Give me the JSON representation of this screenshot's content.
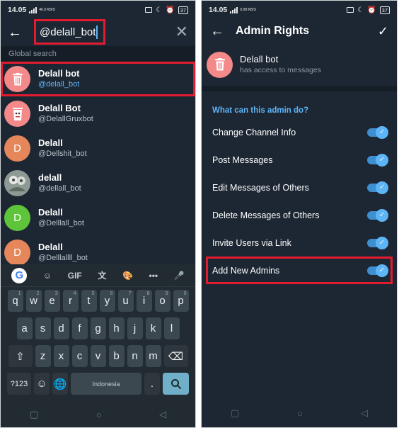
{
  "left": {
    "status": {
      "time": "14.05",
      "speed": "46.0 KB/S",
      "battery": "37"
    },
    "search": {
      "query": "@delall_bot",
      "close_icon": "close-icon",
      "back_icon": "back-arrow-icon"
    },
    "section_label": "Global search",
    "results": [
      {
        "name": "Delall bot",
        "username": "@delall_bot",
        "avatar_color": "#f48989",
        "avatar_icon": "trash-can-icon",
        "highlighted": true
      },
      {
        "name": "Delall Bot",
        "username": "@DelallGruxbot",
        "avatar_color": "#f48989",
        "avatar_icon": "trash-face-icon",
        "highlighted": false
      },
      {
        "name": "Delall",
        "username": "@Dellshit_bot",
        "avatar_color": "#e5875a",
        "avatar_letter": "D",
        "highlighted": false
      },
      {
        "name": "delall",
        "username": "@dellall_bot",
        "avatar_color": "#9aa8a0",
        "avatar_icon": "photo-icon",
        "highlighted": false
      },
      {
        "name": "Delall",
        "username": "@Delllall_bot",
        "avatar_color": "#5ec43a",
        "avatar_letter": "D",
        "highlighted": false
      },
      {
        "name": "Delall",
        "username": "@Delllallll_bot",
        "avatar_color": "#e5875a",
        "avatar_letter": "D",
        "highlighted": false
      }
    ],
    "keyboard": {
      "toolbar": [
        "G",
        "☺",
        "GIF",
        "文",
        "🎨",
        "•••",
        "🎤"
      ],
      "row1": [
        [
          "q",
          "1"
        ],
        [
          "w",
          "2"
        ],
        [
          "e",
          "3"
        ],
        [
          "r",
          "4"
        ],
        [
          "t",
          "5"
        ],
        [
          "y",
          "6"
        ],
        [
          "u",
          "7"
        ],
        [
          "i",
          "8"
        ],
        [
          "o",
          "9"
        ],
        [
          "p",
          "0"
        ]
      ],
      "row2": [
        "a",
        "s",
        "d",
        "f",
        "g",
        "h",
        "j",
        "k",
        "l"
      ],
      "row3": [
        "z",
        "x",
        "c",
        "v",
        "b",
        "n",
        "m"
      ],
      "row4": {
        "symbols": "?123",
        "emoji": "☺",
        "globe": "🌐",
        "space": "Indonesia",
        "period": ".",
        "enter": "search"
      }
    }
  },
  "right": {
    "status": {
      "time": "14.05",
      "speed": "0.08 KB/S",
      "battery": "37"
    },
    "title": "Admin Rights",
    "bot": {
      "name": "Delall bot",
      "subtitle": "has access to messages"
    },
    "permissions_header": "What can this admin do?",
    "permissions": [
      {
        "label": "Change Channel Info",
        "enabled": true,
        "highlighted": false
      },
      {
        "label": "Post Messages",
        "enabled": true,
        "highlighted": false
      },
      {
        "label": "Edit Messages of Others",
        "enabled": true,
        "highlighted": false
      },
      {
        "label": "Delete Messages of Others",
        "enabled": true,
        "highlighted": false
      },
      {
        "label": "Invite Users via Link",
        "enabled": true,
        "highlighted": false
      },
      {
        "label": "Add New Admins",
        "enabled": true,
        "highlighted": true
      }
    ]
  },
  "colors": {
    "bg": "#1d2733",
    "accent": "#5eb5f7",
    "highlight": "#e21b2f"
  }
}
